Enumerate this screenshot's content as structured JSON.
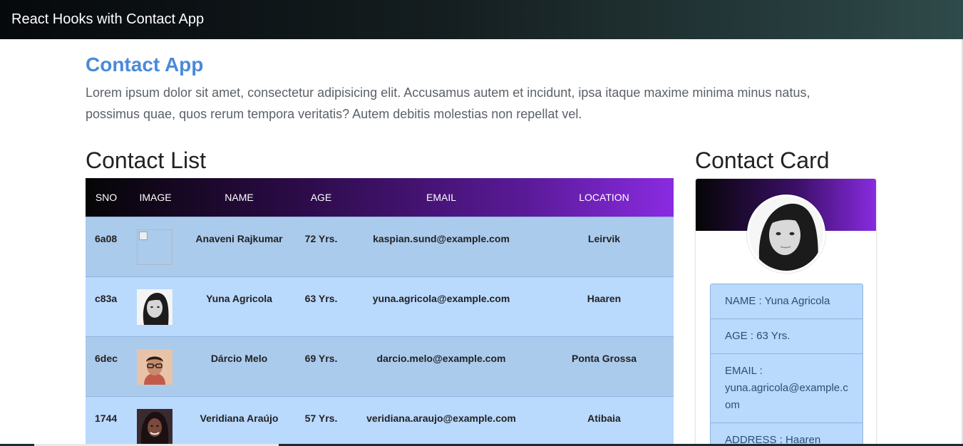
{
  "navbar": {
    "brand": "React Hooks with Contact App"
  },
  "header": {
    "title": "Contact App",
    "intro": "Lorem ipsum dolor sit amet, consectetur adipisicing elit. Accusamus autem et incidunt, ipsa itaque maxime minima minus natus, possimus quae, quos rerum tempora veritatis? Autem debitis molestias non repellat vel."
  },
  "contact_list": {
    "title": "Contact List",
    "columns": [
      "SNO",
      "IMAGE",
      "NAME",
      "AGE",
      "EMAIL",
      "LOCATION"
    ],
    "rows": [
      {
        "sno": "6a08",
        "image": "broken-image",
        "name": "Anaveni Rajkumar",
        "age": "72 Yrs.",
        "email": "kaspian.sund@example.com",
        "location": "Leirvik"
      },
      {
        "sno": "c83a",
        "image": "woman-bw-photo",
        "name": "Yuna Agricola",
        "age": "63 Yrs.",
        "email": "yuna.agricola@example.com",
        "location": "Haaren"
      },
      {
        "sno": "6dec",
        "image": "man-glasses-photo",
        "name": "Dárcio Melo",
        "age": "69 Yrs.",
        "email": "darcio.melo@example.com",
        "location": "Ponta Grossa"
      },
      {
        "sno": "1744",
        "image": "woman-dark-photo",
        "name": "Veridiana Araújo",
        "age": "57 Yrs.",
        "email": "veridiana.araujo@example.com",
        "location": "Atibaia"
      }
    ]
  },
  "contact_card": {
    "title": "Contact Card",
    "items": [
      "NAME : Yuna Agricola",
      "AGE : 63 Yrs.",
      "EMAIL : yuna.agricola@example.com",
      "ADDRESS : Haaren"
    ]
  },
  "colors": {
    "accent": "#4a8ad8",
    "row_dark": "#abcbec",
    "row_light": "#b9d9fd",
    "header_gradient_end": "#8a2be2"
  }
}
